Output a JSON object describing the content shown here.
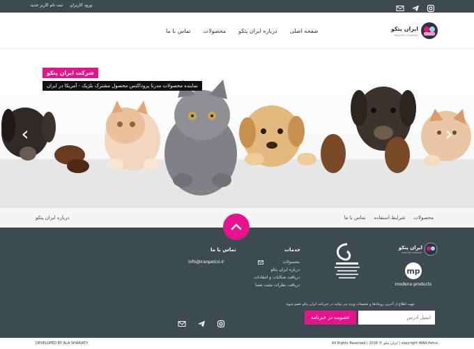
{
  "topbar": {
    "links": [
      "ورود کاربران",
      "ثبت نام کاربر جدید"
    ],
    "icons": [
      "instagram-icon",
      "telegram-icon",
      "email-icon"
    ]
  },
  "header": {
    "logo_fa": "ایران پتکو",
    "logo_en": "IRAN PET COMPANY",
    "nav": [
      "صفحه اصلی",
      "درباره ایران پتکو",
      "محصولات",
      "تماس با ما"
    ]
  },
  "hero": {
    "title": "شرکت ایران پتکو",
    "subtitle": "نماینده محصولات مدرنا پروداکتس محصول مشترک بلژیک - آمریکا در ایران",
    "prev": "‹",
    "next": "›"
  },
  "subnav": {
    "left": "درباره ایران پتکو",
    "right": [
      "محصولات",
      "شرایط استفاده",
      "تماس با ما"
    ]
  },
  "footer": {
    "services_title": "خدمات",
    "services": [
      "محصولات",
      "درباره ایران پتکو",
      "دریافت شکایات و انتقادات",
      "دریافت نظرات مثبت شما"
    ],
    "contact_title": "تماس با ما",
    "contact_email": "info@iranpetco.ir",
    "brand_fa": "ایران پتکو",
    "brand_en": "IRAN PET COMPANY",
    "modena_text": "modena products",
    "newsletter_text": "جهت اطلاع از آخرین رویدادها و تخفیفات ویژه می توانید در خبرنامه ایران پتکو عضو شوید",
    "email_placeholder": "ایمیل آدرس",
    "subscribe_label": "عضویت در خبرنامه",
    "icons": [
      "email-icon",
      "telegram-icon",
      "instagram-icon"
    ]
  },
  "bottom": {
    "developer": "DEVELOPED BY ALA SHARIATY",
    "copyright": "All Rights Reserved | 2016 © ایران پتکو | copyright IRAN Petco"
  },
  "colors": {
    "accent": "#e8138c",
    "dark": "#3d4a52"
  }
}
